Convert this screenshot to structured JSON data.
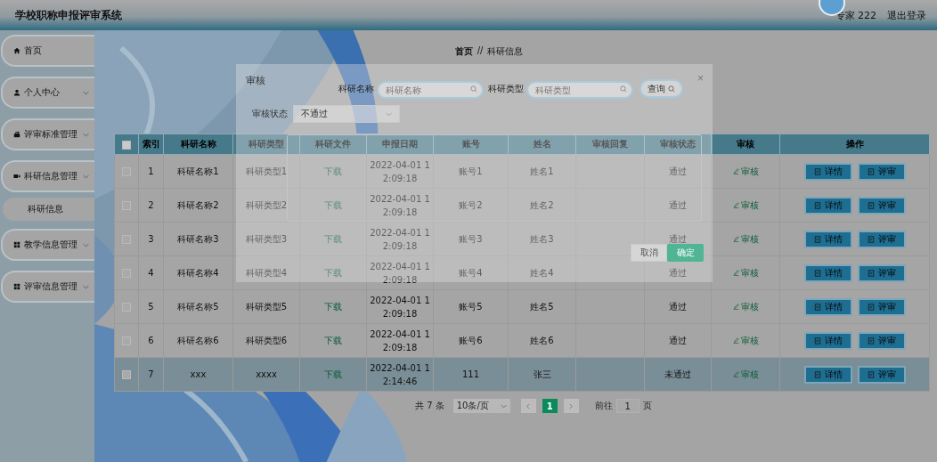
{
  "header": {
    "title": "学校职称申报评审系统",
    "user": "专家 222",
    "logout": "退出登录"
  },
  "sidebar": {
    "items": [
      {
        "kind": "link",
        "label": "首页"
      },
      {
        "kind": "group",
        "label": "个人中心"
      },
      {
        "kind": "group",
        "label": "评审标准管理"
      },
      {
        "kind": "group",
        "label": "科研信息管理",
        "expanded": true,
        "children": [
          {
            "label": "科研信息"
          }
        ]
      },
      {
        "kind": "group",
        "label": "教学信息管理"
      },
      {
        "kind": "group",
        "label": "评审信息管理"
      }
    ]
  },
  "breadcrumb": [
    "首页",
    "//",
    "科研信息"
  ],
  "table": {
    "all_checked": false,
    "columns": [
      "索引",
      "科研名称",
      "科研类型",
      "科研文件",
      "申报日期",
      "账号",
      "姓名",
      "审核回复",
      "审核状态",
      "审核",
      "操作"
    ],
    "rows": [
      {
        "checked": false,
        "selected": false,
        "index": "1",
        "name": "科研名称1",
        "type": "科研类型1",
        "file": "下载",
        "date": "2022-04-01 12:09:18",
        "account": "账号1",
        "person": "姓名1",
        "reply": "",
        "status": "通过",
        "review": "审核",
        "actions": [
          "详情",
          "评审"
        ]
      },
      {
        "checked": false,
        "selected": false,
        "index": "2",
        "name": "科研名称2",
        "type": "科研类型2",
        "file": "下载",
        "date": "2022-04-01 12:09:18",
        "account": "账号2",
        "person": "姓名2",
        "reply": "",
        "status": "通过",
        "review": "审核",
        "actions": [
          "详情",
          "评审"
        ]
      },
      {
        "checked": false,
        "selected": false,
        "index": "3",
        "name": "科研名称3",
        "type": "科研类型3",
        "file": "下载",
        "date": "2022-04-01 12:09:18",
        "account": "账号3",
        "person": "姓名3",
        "reply": "",
        "status": "通过",
        "review": "审核",
        "actions": [
          "详情",
          "评审"
        ]
      },
      {
        "checked": false,
        "selected": false,
        "index": "4",
        "name": "科研名称4",
        "type": "科研类型4",
        "file": "下载",
        "date": "2022-04-01 12:09:18",
        "account": "账号4",
        "person": "姓名4",
        "reply": "",
        "status": "通过",
        "review": "审核",
        "actions": [
          "详情",
          "评审"
        ]
      },
      {
        "checked": false,
        "selected": false,
        "index": "5",
        "name": "科研名称5",
        "type": "科研类型5",
        "file": "下载",
        "date": "2022-04-01 12:09:18",
        "account": "账号5",
        "person": "姓名5",
        "reply": "",
        "status": "通过",
        "review": "审核",
        "actions": [
          "详情",
          "评审"
        ]
      },
      {
        "checked": false,
        "selected": false,
        "index": "6",
        "name": "科研名称6",
        "type": "科研类型6",
        "file": "下载",
        "date": "2022-04-01 12:09:18",
        "account": "账号6",
        "person": "姓名6",
        "reply": "",
        "status": "通过",
        "review": "审核",
        "actions": [
          "详情",
          "评审"
        ]
      },
      {
        "checked": false,
        "selected": true,
        "index": "7",
        "name": "xxx",
        "type": "xxxx",
        "file": "下载",
        "date": "2022-04-01 12:14:46",
        "account": "111",
        "person": "张三",
        "reply": "",
        "status": "未通过",
        "review": "审核",
        "actions": [
          "详情",
          "评审"
        ]
      }
    ]
  },
  "pagination": {
    "total": "共 7 条",
    "page_size": "10条/页",
    "pages": [
      {
        "label": "1",
        "selected": true
      }
    ],
    "goto_label": "前往",
    "goto_value": "1",
    "goto_suffix": "页"
  },
  "dialog": {
    "title": "审核",
    "close": "×",
    "search": [
      {
        "label": "科研名称",
        "placeholder": "科研名称"
      },
      {
        "label": "科研类型",
        "placeholder": "科研类型"
      }
    ],
    "search_button": "查询",
    "status_label": "审核状态",
    "status_value": "不通过",
    "cancel": "取消",
    "confirm": "确定"
  }
}
